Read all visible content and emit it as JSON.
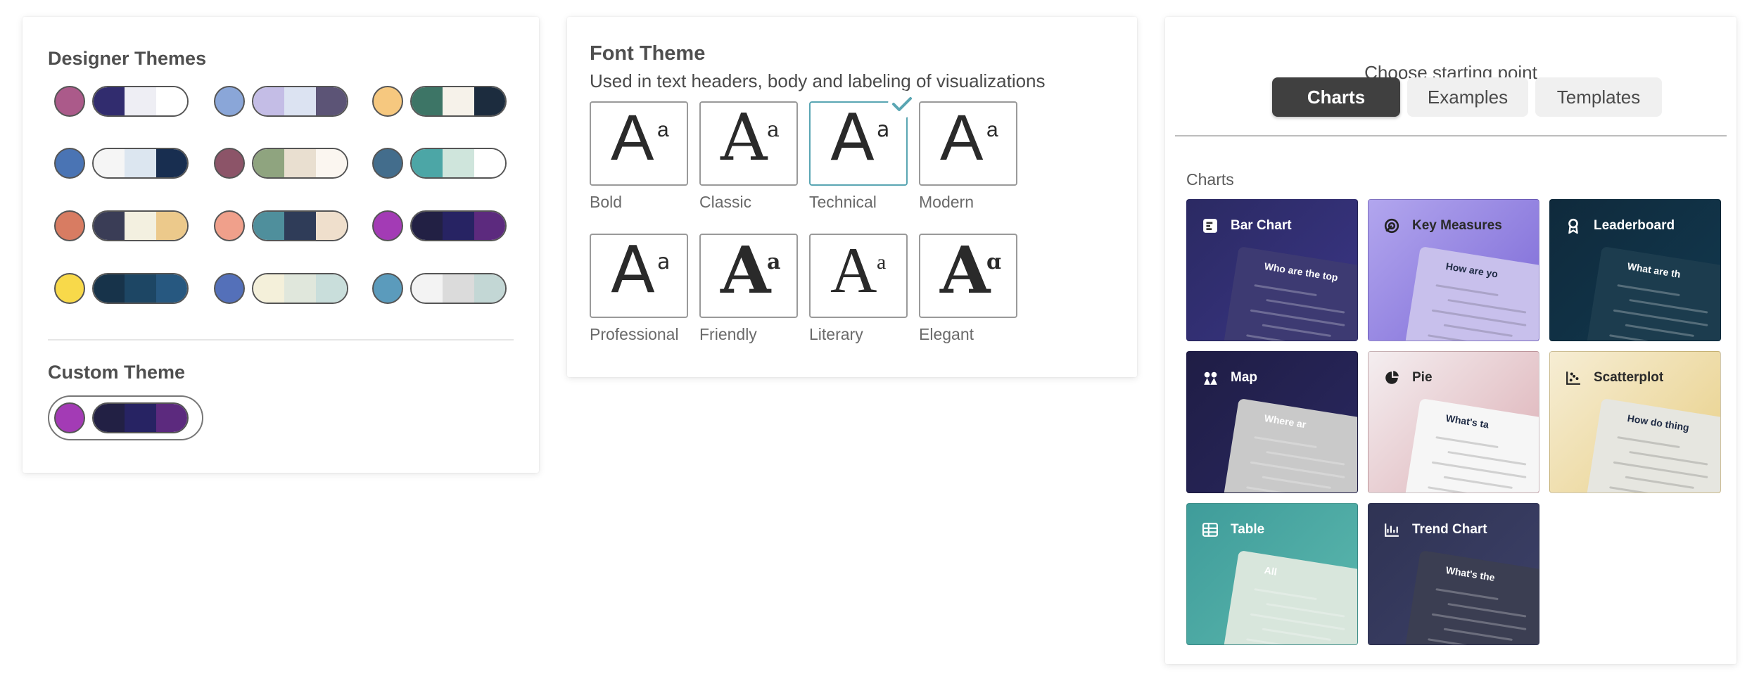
{
  "designer_themes": {
    "title": "Designer Themes",
    "themes": [
      {
        "dot": "#ab5a8a",
        "colors": [
          "#312c6e",
          "#eeeef4",
          "#ffffff"
        ]
      },
      {
        "dot": "#8aa6d8",
        "colors": [
          "#c4bde6",
          "#dce3f2",
          "#5c5476"
        ]
      },
      {
        "dot": "#f6c87f",
        "colors": [
          "#3d7566",
          "#f6f2ea",
          "#1c2c3e"
        ]
      },
      {
        "dot": "#4a74b4",
        "colors": [
          "#f5f5f5",
          "#dce6f0",
          "#182e50"
        ]
      },
      {
        "dot": "#8c5468",
        "colors": [
          "#8fa47f",
          "#e9dfd0",
          "#fbf6f0"
        ]
      },
      {
        "dot": "#436d8c",
        "colors": [
          "#4ca6a6",
          "#cfe5dc",
          "#ffffff"
        ]
      },
      {
        "dot": "#d87c62",
        "colors": [
          "#3a3d56",
          "#f3f0e0",
          "#ecc98b"
        ]
      },
      {
        "dot": "#f0a08b",
        "colors": [
          "#4f8f9c",
          "#2f3c58",
          "#efdfcc"
        ]
      },
      {
        "dot": "#a33bb5",
        "colors": [
          "#222044",
          "#272363",
          "#5c2a7e"
        ]
      },
      {
        "dot": "#f8d94a",
        "colors": [
          "#17334a",
          "#1d4664",
          "#275880"
        ]
      },
      {
        "dot": "#5470b9",
        "colors": [
          "#f4f0da",
          "#e0e7dc",
          "#c9dedb"
        ]
      },
      {
        "dot": "#5b9bbc",
        "colors": [
          "#f3f3f3",
          "#dbdbdb",
          "#c3d7d5"
        ]
      }
    ]
  },
  "custom_theme": {
    "title": "Custom Theme",
    "dot": "#a33bb5",
    "colors": [
      "#222044",
      "#272363",
      "#5c2a7e"
    ]
  },
  "font_theme": {
    "title": "Font Theme",
    "subtitle": "Used in text headers, body and labeling of visualizations",
    "options": [
      {
        "label": "Bold",
        "big": "A",
        "small": "a",
        "family": "Liberation Sans",
        "weight": "normal"
      },
      {
        "label": "Classic",
        "big": "A",
        "small": "a",
        "family": "DejaVu Serif",
        "weight": "normal"
      },
      {
        "label": "Technical",
        "big": "A",
        "small": "a",
        "family": "DejaVu Sans",
        "weight": "normal"
      },
      {
        "label": "Modern",
        "big": "A",
        "small": "a",
        "family": "Liberation Sans",
        "weight": "normal"
      },
      {
        "label": "Professional",
        "big": "A",
        "small": "a",
        "family": "DejaVu Sans",
        "weight": "normal"
      },
      {
        "label": "Friendly",
        "big": "A",
        "small": "a",
        "family": "DejaVu Serif",
        "weight": "bold"
      },
      {
        "label": "Literary",
        "big": "A",
        "small": "a",
        "family": "Liberation Serif",
        "weight": "normal"
      },
      {
        "label": "Elegant",
        "big": "A",
        "small": "ɑ",
        "family": "DejaVu Serif",
        "weight": "bold"
      }
    ],
    "selected": "Technical",
    "accent": "#5aa6b3"
  },
  "starting_point": {
    "heading": "Choose starting point",
    "tabs": [
      "Charts",
      "Examples",
      "Templates"
    ],
    "active_tab": "Charts",
    "section_label": "Charts",
    "cards": [
      {
        "label": "Bar Chart",
        "icon": "bar-chart-icon",
        "bg": "linear-gradient(135deg,#2b2a63,#3a3585)",
        "preview_bg": "#3d3a72",
        "preview_title": "Who are the top",
        "text_dark": false
      },
      {
        "label": "Key Measures",
        "icon": "key-measures-icon",
        "bg": "linear-gradient(135deg,#b2a6ee,#7b68d6)",
        "preview_bg": "#c8c0ec",
        "preview_title": "How are yo",
        "text_dark": true
      },
      {
        "label": "Leaderboard",
        "icon": "leaderboard-icon",
        "bg": "linear-gradient(135deg,#0f2a3c,#12384e)",
        "preview_bg": "#1c3c4e",
        "preview_title": "What are th",
        "text_dark": false
      },
      {
        "label": "Map",
        "icon": "map-icon",
        "bg": "linear-gradient(135deg,#1f1d45,#2a2860)",
        "preview_bg": "#c9c9c9",
        "preview_title": "Where ar",
        "text_dark": false
      },
      {
        "label": "Pie",
        "icon": "pie-icon",
        "bg": "linear-gradient(135deg,#f4eef0,#dcaeb4)",
        "preview_bg": "#f6f6f6",
        "preview_title": "What's ta",
        "text_dark": true
      },
      {
        "label": "Scatterplot",
        "icon": "scatterplot-icon",
        "bg": "linear-gradient(135deg,#f6edd4,#e8cf86)",
        "preview_bg": "#e6e6e0",
        "preview_title": "How do thing",
        "text_dark": true
      },
      {
        "label": "Table",
        "icon": "table-icon",
        "bg": "linear-gradient(135deg,#3f9c9a,#5cb8ae)",
        "preview_bg": "#d8e6dc",
        "preview_title": "All",
        "text_dark": false
      },
      {
        "label": "Trend Chart",
        "icon": "trend-chart-icon",
        "bg": "linear-gradient(135deg,#2f3354,#3d4168)",
        "preview_bg": "#3b3e52",
        "preview_title": "What's the",
        "text_dark": false
      }
    ]
  }
}
